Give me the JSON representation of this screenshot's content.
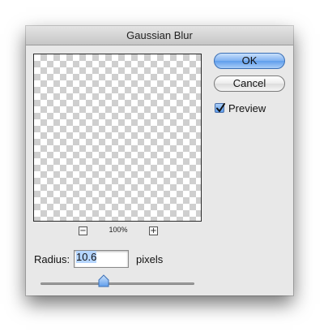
{
  "dialog": {
    "title": "Gaussian Blur"
  },
  "preview": {
    "zoom_level": "100%",
    "zoom_out_symbol": "−",
    "zoom_in_symbol": "+",
    "checkbox_label": "Preview",
    "checkbox_checked": true
  },
  "buttons": {
    "ok_label": "OK",
    "cancel_label": "Cancel"
  },
  "radius": {
    "label": "Radius:",
    "value": "10.6",
    "units": "pixels",
    "slider_fraction": 0.41
  },
  "colors": {
    "default_button": "#7fb1f1",
    "selection": "#b5d5ff"
  },
  "icons": {
    "zoom_out": "minus-icon",
    "zoom_in": "plus-icon",
    "checkmark": "checkmark-icon",
    "slider_thumb": "slider-thumb-icon"
  }
}
